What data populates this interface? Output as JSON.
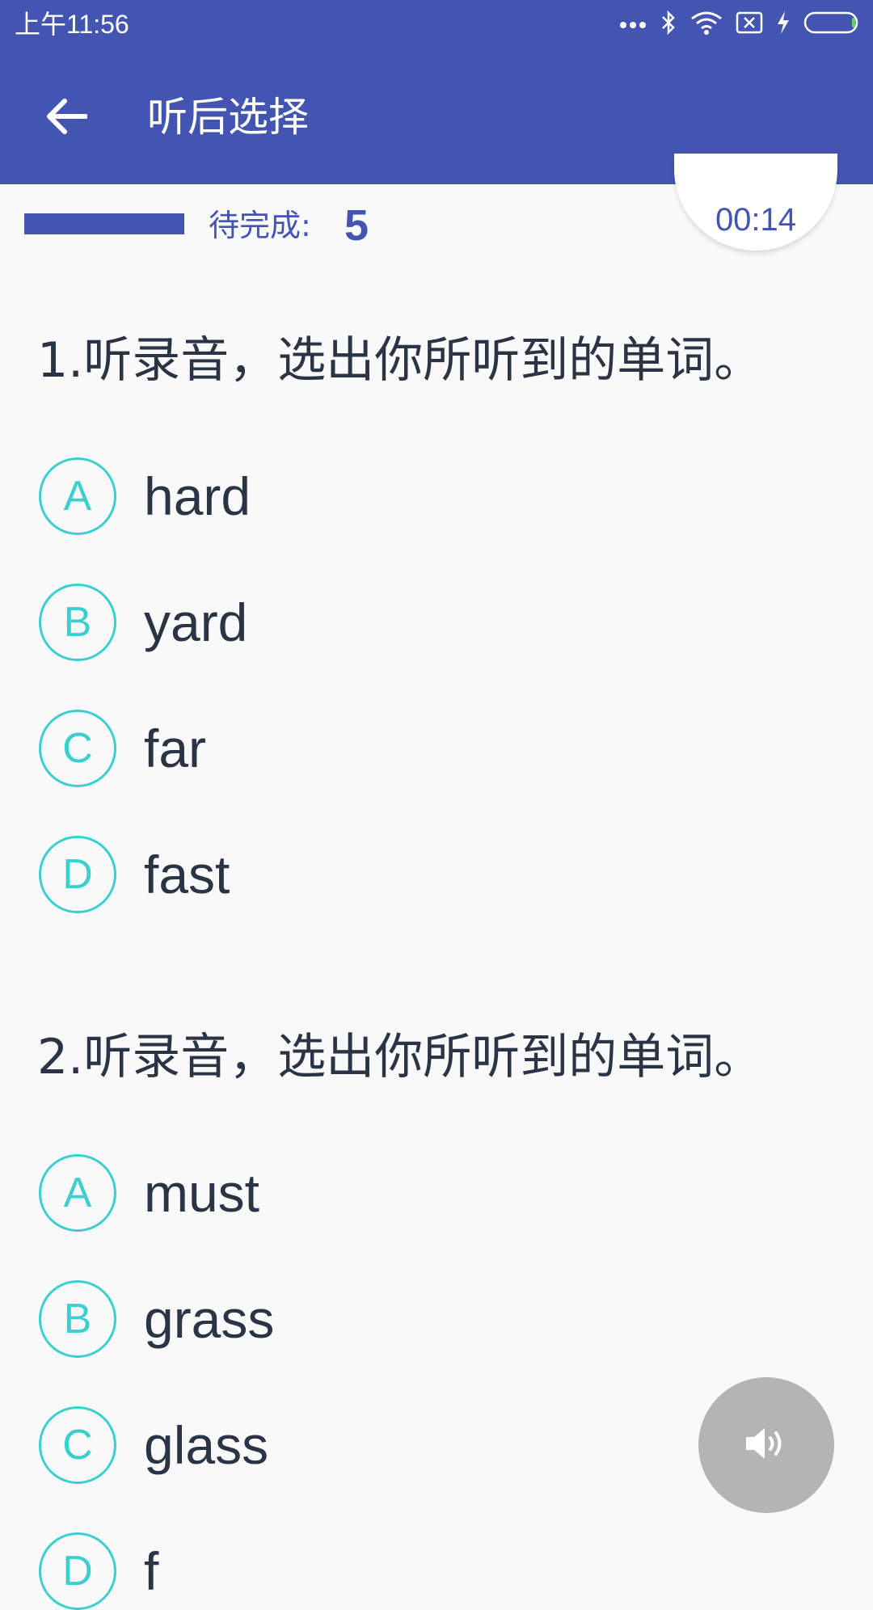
{
  "status_bar": {
    "time": "上午11:56",
    "icons": [
      "more-dots-icon",
      "bluetooth-icon",
      "wifi-icon",
      "sim-card-icon",
      "charging-icon",
      "battery-icon"
    ]
  },
  "app_bar": {
    "title": "听后选择",
    "back_icon": "arrow-left-icon"
  },
  "progress": {
    "remaining_label": "待完成:",
    "remaining_count": "5",
    "timer": "00:14"
  },
  "questions": [
    {
      "prompt": "1.听录音，选出你所听到的单词。",
      "options": [
        {
          "letter": "A",
          "text": "hard"
        },
        {
          "letter": "B",
          "text": "yard"
        },
        {
          "letter": "C",
          "text": "far"
        },
        {
          "letter": "D",
          "text": "fast"
        }
      ]
    },
    {
      "prompt": "2.听录音，选出你所听到的单词。",
      "options": [
        {
          "letter": "A",
          "text": "must"
        },
        {
          "letter": "B",
          "text": "grass"
        },
        {
          "letter": "C",
          "text": "glass"
        },
        {
          "letter": "D",
          "text": "f"
        }
      ]
    }
  ],
  "audio_button": {
    "icon": "speaker-icon"
  },
  "colors": {
    "primary": "#4355b1",
    "accent": "#3ccfcf",
    "text": "#2b3445",
    "background": "#f9f9f9"
  }
}
